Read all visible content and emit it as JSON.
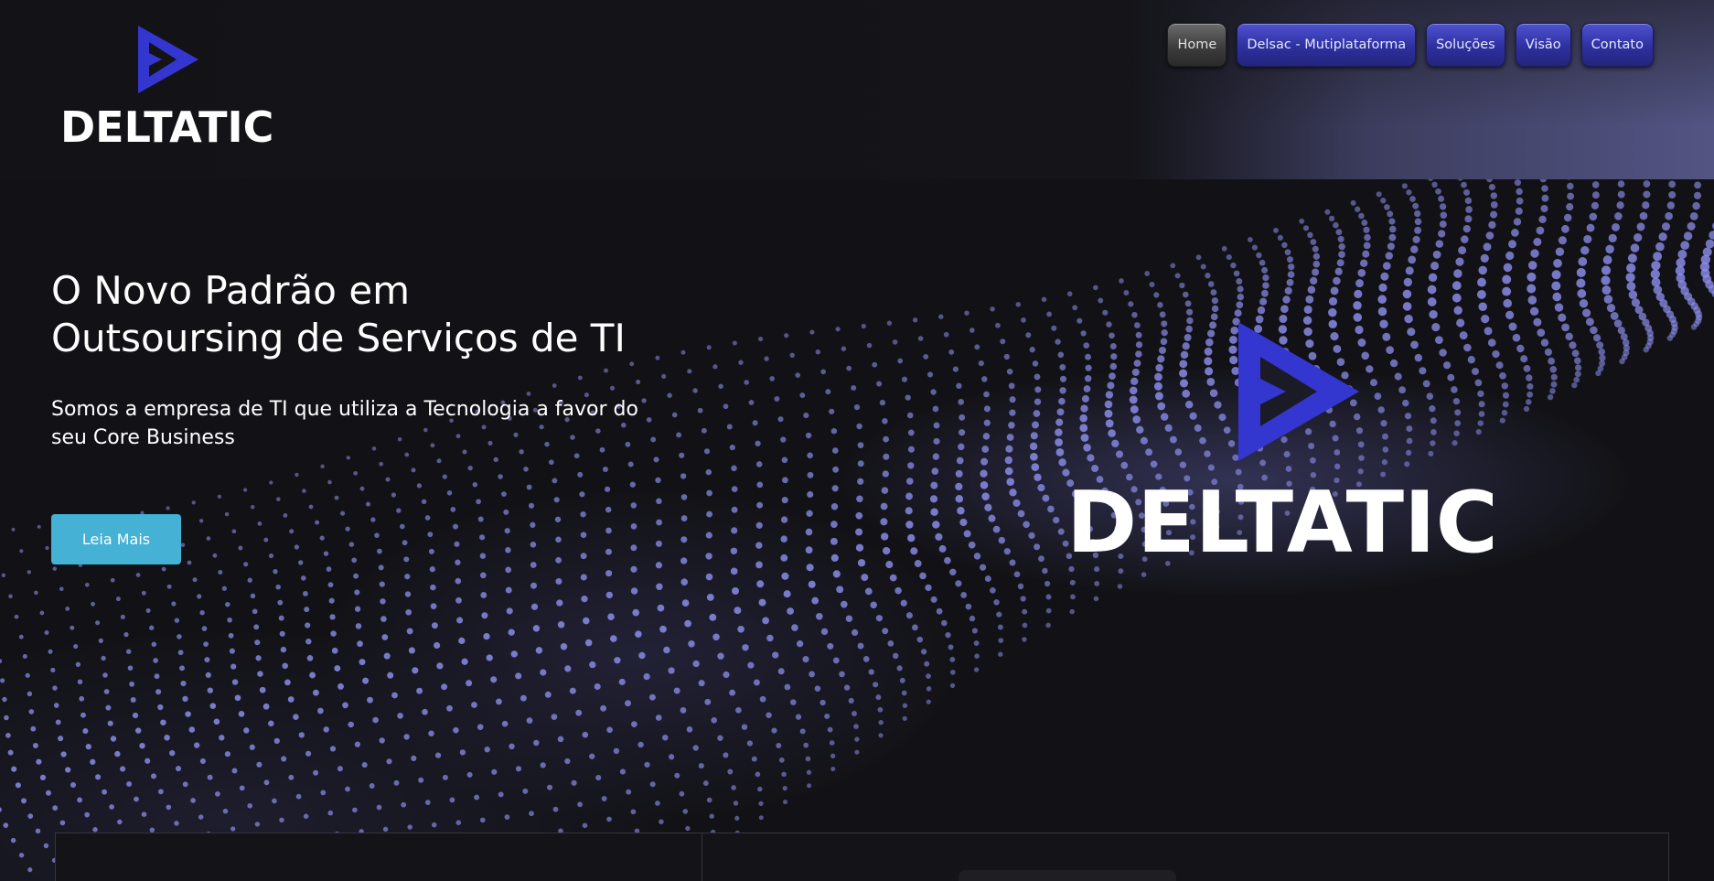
{
  "brand": {
    "name": "DELTATIC",
    "accent_color": "#3032c9",
    "logo_icon": "delta-play-icon"
  },
  "nav": {
    "items": [
      {
        "label": "Home",
        "active": true
      },
      {
        "label": "Delsac - Mutiplataforma",
        "active": false
      },
      {
        "label": "Soluções",
        "active": false
      },
      {
        "label": "Visão",
        "active": false
      },
      {
        "label": "Contato",
        "active": false
      }
    ],
    "active_color": "#4a4a4a",
    "button_color": "#2e30a0"
  },
  "hero": {
    "title_line1": "O Novo Padrão em",
    "title_line2": "Outsoursing de Serviços de TI",
    "subtitle": "Somos a empresa de TI que utiliza a Tecnologia a favor do seu Core Business",
    "cta_label": "Leia Mais",
    "cta_color": "#45b1d5",
    "logo_name": "DELTATIC"
  }
}
